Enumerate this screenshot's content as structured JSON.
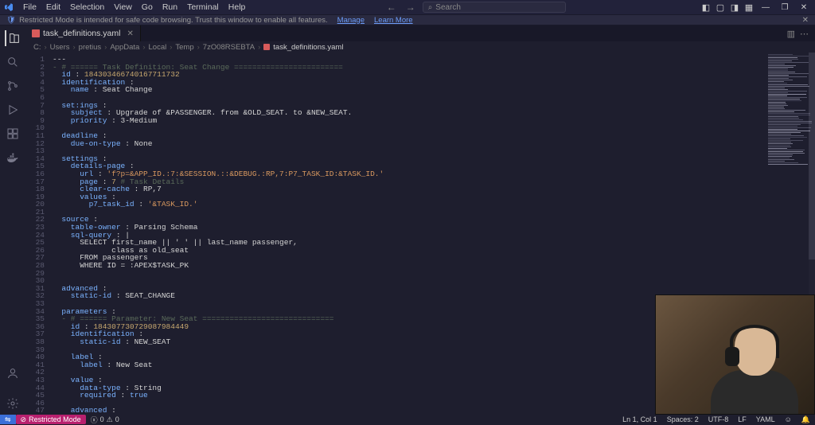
{
  "menu": [
    "File",
    "Edit",
    "Selection",
    "View",
    "Go",
    "Run",
    "Terminal",
    "Help"
  ],
  "search_placeholder": "Search",
  "infobar": {
    "text": "Restricted Mode is intended for safe code browsing. Trust this window to enable all features.",
    "manage": "Manage",
    "learn": "Learn More"
  },
  "tab": {
    "name": "task_definitions.yaml"
  },
  "breadcrumb": [
    "C:",
    "Users",
    "pretius",
    "AppData",
    "Local",
    "Temp",
    "7zO08RSEBTA",
    "task_definitions.yaml"
  ],
  "code": [
    {
      "n": 1,
      "seg": [
        [
          "",
          "---"
        ]
      ]
    },
    {
      "n": 2,
      "seg": [
        [
          "com",
          "- # ====== Task Definition: Seat Change ========================"
        ]
      ]
    },
    {
      "n": 3,
      "seg": [
        [
          "key",
          "  id"
        ],
        [
          "",
          " : "
        ],
        [
          "num",
          "184303466740167711732"
        ]
      ]
    },
    {
      "n": 4,
      "seg": [
        [
          "key",
          "  identification"
        ],
        [
          "",
          " :"
        ]
      ]
    },
    {
      "n": 5,
      "seg": [
        [
          "key",
          "    name"
        ],
        [
          "",
          " : "
        ],
        [
          "",
          "Seat Change"
        ]
      ]
    },
    {
      "n": 6,
      "seg": [
        [
          "",
          ""
        ]
      ]
    },
    {
      "n": 7,
      "seg": [
        [
          "key",
          "  set:ings"
        ],
        [
          "",
          " :"
        ]
      ]
    },
    {
      "n": 8,
      "seg": [
        [
          "key",
          "    subject"
        ],
        [
          "",
          " : "
        ],
        [
          "",
          "Upgrade of &PASSENGER. from &OLD_SEAT. to &NEW_SEAT."
        ]
      ]
    },
    {
      "n": 9,
      "seg": [
        [
          "key",
          "    priority"
        ],
        [
          "",
          " : "
        ],
        [
          "",
          "3-Medium"
        ]
      ]
    },
    {
      "n": 10,
      "seg": [
        [
          "",
          ""
        ]
      ]
    },
    {
      "n": 11,
      "seg": [
        [
          "key",
          "  deadline"
        ],
        [
          "",
          " :"
        ]
      ]
    },
    {
      "n": 12,
      "seg": [
        [
          "key",
          "    due-on-type"
        ],
        [
          "",
          " : "
        ],
        [
          "",
          "None"
        ]
      ]
    },
    {
      "n": 13,
      "seg": [
        [
          "",
          ""
        ]
      ]
    },
    {
      "n": 14,
      "seg": [
        [
          "key",
          "  settings"
        ],
        [
          "",
          " :"
        ]
      ]
    },
    {
      "n": 15,
      "seg": [
        [
          "key",
          "    details-page"
        ],
        [
          "",
          " :"
        ]
      ]
    },
    {
      "n": 16,
      "seg": [
        [
          "key",
          "      url"
        ],
        [
          "",
          " : "
        ],
        [
          "str",
          "'f?p=&APP_ID.:7:&SESSION.::&DEBUG.:RP,7:P7_TASK_ID:&TASK_ID.'"
        ]
      ]
    },
    {
      "n": 17,
      "seg": [
        [
          "key",
          "      page"
        ],
        [
          "",
          " : "
        ],
        [
          "num",
          "7 "
        ],
        [
          "com",
          "# Task Details"
        ]
      ]
    },
    {
      "n": 18,
      "seg": [
        [
          "key",
          "      clear-cache"
        ],
        [
          "",
          " : "
        ],
        [
          "",
          "RP,7"
        ]
      ]
    },
    {
      "n": 19,
      "seg": [
        [
          "key",
          "      values"
        ],
        [
          "",
          " :"
        ]
      ]
    },
    {
      "n": 20,
      "seg": [
        [
          "key",
          "        p7_task_id"
        ],
        [
          "",
          " : "
        ],
        [
          "str",
          "'&TASK_ID.'"
        ]
      ]
    },
    {
      "n": 21,
      "seg": [
        [
          "",
          ""
        ]
      ]
    },
    {
      "n": 22,
      "seg": [
        [
          "key",
          "  source"
        ],
        [
          "",
          " :"
        ]
      ]
    },
    {
      "n": 23,
      "seg": [
        [
          "key",
          "    table-owner"
        ],
        [
          "",
          " : "
        ],
        [
          "",
          "Parsing Schema"
        ]
      ]
    },
    {
      "n": 24,
      "seg": [
        [
          "key",
          "    sql-query"
        ],
        [
          "",
          " : "
        ],
        [
          "",
          "|"
        ]
      ]
    },
    {
      "n": 25,
      "seg": [
        [
          "",
          "      SELECT first_name || ' ' || last_name passenger,"
        ]
      ]
    },
    {
      "n": 26,
      "seg": [
        [
          "",
          "             class as old_seat"
        ]
      ]
    },
    {
      "n": 27,
      "seg": [
        [
          "",
          "      FROM passengers"
        ]
      ]
    },
    {
      "n": 28,
      "seg": [
        [
          "",
          "      WHERE ID = :APEX$TASK_PK"
        ]
      ]
    },
    {
      "n": 29,
      "seg": [
        [
          "",
          ""
        ]
      ]
    },
    {
      "n": 30,
      "seg": [
        [
          "",
          ""
        ]
      ]
    },
    {
      "n": 31,
      "seg": [
        [
          "key",
          "  advanced"
        ],
        [
          "",
          " :"
        ]
      ]
    },
    {
      "n": 32,
      "seg": [
        [
          "key",
          "    static-id"
        ],
        [
          "",
          " : "
        ],
        [
          "",
          "SEAT_CHANGE"
        ]
      ]
    },
    {
      "n": 33,
      "seg": [
        [
          "",
          ""
        ]
      ]
    },
    {
      "n": 34,
      "seg": [
        [
          "key",
          "  parameters"
        ],
        [
          "",
          " :"
        ]
      ]
    },
    {
      "n": 35,
      "seg": [
        [
          "com",
          "  - # ====== Parameter: New Seat ============================="
        ]
      ]
    },
    {
      "n": 36,
      "seg": [
        [
          "key",
          "    id"
        ],
        [
          "",
          " : "
        ],
        [
          "num",
          "184307730729087984449"
        ]
      ]
    },
    {
      "n": 37,
      "seg": [
        [
          "key",
          "    identification"
        ],
        [
          "",
          " :"
        ]
      ]
    },
    {
      "n": 38,
      "seg": [
        [
          "key",
          "      static-id"
        ],
        [
          "",
          " : "
        ],
        [
          "",
          "NEW_SEAT"
        ]
      ]
    },
    {
      "n": 39,
      "seg": [
        [
          "",
          ""
        ]
      ]
    },
    {
      "n": 40,
      "seg": [
        [
          "key",
          "    label"
        ],
        [
          "",
          " :"
        ]
      ]
    },
    {
      "n": 41,
      "seg": [
        [
          "key",
          "      label"
        ],
        [
          "",
          " : "
        ],
        [
          "",
          "New Seat"
        ]
      ]
    },
    {
      "n": 42,
      "seg": [
        [
          "",
          ""
        ]
      ]
    },
    {
      "n": 43,
      "seg": [
        [
          "key",
          "    value"
        ],
        [
          "",
          " :"
        ]
      ]
    },
    {
      "n": 44,
      "seg": [
        [
          "key",
          "      data-type"
        ],
        [
          "",
          " : "
        ],
        [
          "",
          "String"
        ]
      ]
    },
    {
      "n": 45,
      "seg": [
        [
          "key",
          "      required"
        ],
        [
          "",
          " : "
        ],
        [
          "bool",
          "true"
        ]
      ]
    },
    {
      "n": 46,
      "seg": [
        [
          "",
          ""
        ]
      ]
    },
    {
      "n": 47,
      "seg": [
        [
          "key",
          "    advanced"
        ],
        [
          "",
          " :"
        ]
      ]
    }
  ],
  "status": {
    "remote_icon": "⇋",
    "restricted": "Restricted Mode",
    "errors": "0",
    "warnings": "0",
    "position": "Ln 1, Col 1",
    "spaces": "Spaces: 2",
    "encoding": "UTF-8",
    "eol": "LF",
    "lang": "YAML"
  }
}
